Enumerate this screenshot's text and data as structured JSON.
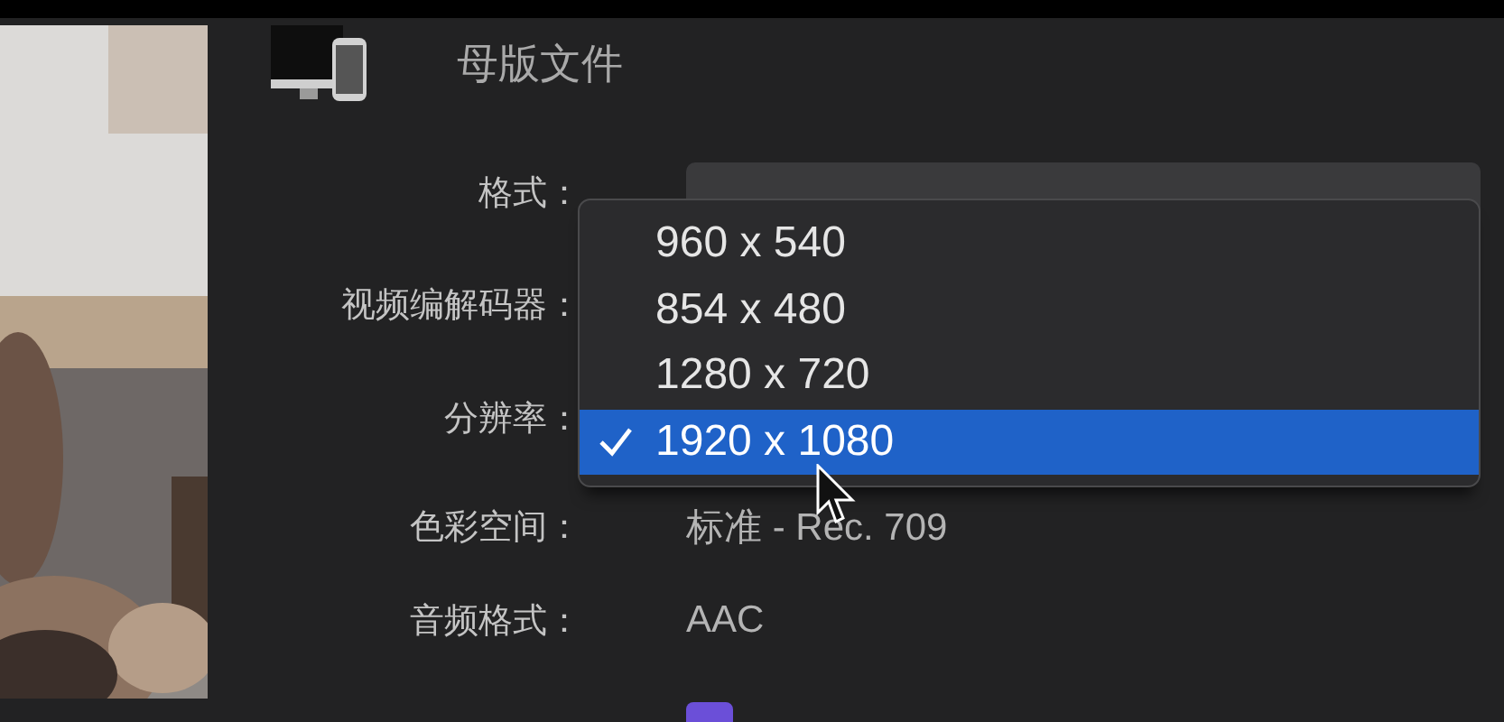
{
  "header": {
    "title": "母版文件"
  },
  "settings": [
    {
      "label": "格式：",
      "kind": "popup"
    },
    {
      "label": "视频编解码器：",
      "kind": "covered"
    },
    {
      "label": "分辨率：",
      "kind": "covered"
    },
    {
      "label": "色彩空间：",
      "kind": "text",
      "value": "标准 - Rec. 709"
    },
    {
      "label": "音频格式：",
      "kind": "text",
      "value": "AAC"
    }
  ],
  "resolution_menu": [
    {
      "label": "960 x 540",
      "selected": false
    },
    {
      "label": "854 x 480",
      "selected": false
    },
    {
      "label": "1280 x 720",
      "selected": false
    },
    {
      "label": "1920 x 1080",
      "selected": true
    }
  ]
}
